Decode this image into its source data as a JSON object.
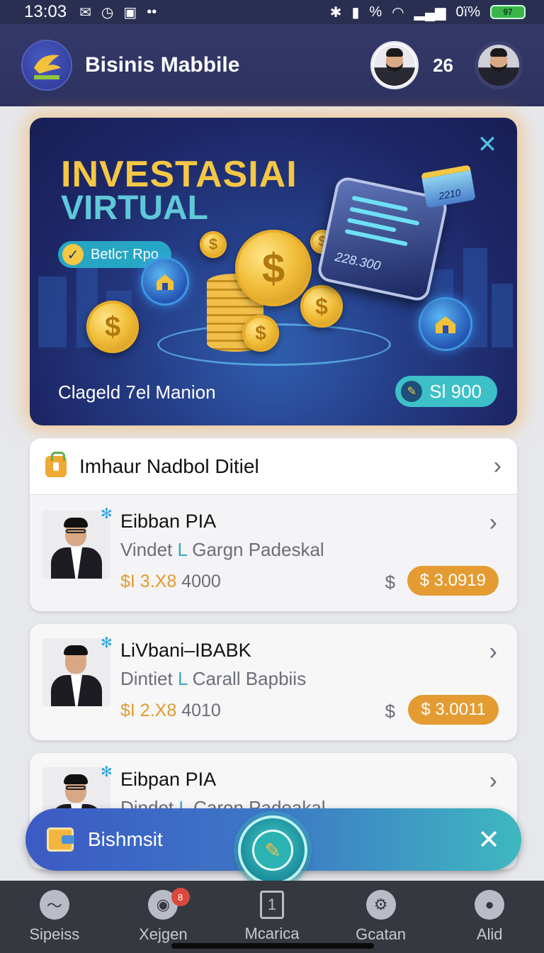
{
  "status_bar": {
    "time": "13:03",
    "battery_text": "97",
    "signal_text": "0ï%"
  },
  "header": {
    "logo_text": "Bisinis",
    "title": "Bisinis Mabbile",
    "count": "26"
  },
  "banner": {
    "headline_line1": "INVESTASIAI",
    "headline_line2": "VIRTUAL",
    "pill_label": "Betlст Rpo",
    "phone_value": "228.300",
    "chip_value": "2210",
    "caption": "Clageld 7el Manion",
    "amount": "Sl 900"
  },
  "section": {
    "title": "Imhaur Nadbol Ditiel"
  },
  "people": [
    {
      "name": "Eibban PIA",
      "sub_a": "Vindet",
      "sub_sep": "L",
      "sub_b": "Gargn Padeskal",
      "value_main": "$I 3.X8",
      "value_tail": "4000",
      "currency": "$",
      "badge": "$ 3.0919"
    },
    {
      "name": "LiVbani–IBABK",
      "sub_a": "Dintiet",
      "sub_sep": "L",
      "sub_b": "Carall Bapbiis",
      "value_main": "$I 2.X8",
      "value_tail": "4010",
      "currency": "$",
      "badge": "$ 3.0011"
    },
    {
      "name": "Eibpan PIA",
      "sub_a": "Dindet",
      "sub_sep": "L",
      "sub_b": "Caron Padeakal"
    }
  ],
  "floatbar": {
    "label": "Bishmsit"
  },
  "nav": [
    {
      "label": "Sipeiss",
      "icon": "wave-icon"
    },
    {
      "label": "Xejgen",
      "icon": "gamepad-icon",
      "badge": "8"
    },
    {
      "label": "Mcarica",
      "icon": "document-icon"
    },
    {
      "label": "Gcatan",
      "icon": "gear-icon"
    },
    {
      "label": "Alid",
      "icon": "user-icon"
    }
  ],
  "colors": {
    "appbar": "#2d3260",
    "accent_orange": "#e39b32",
    "accent_teal": "#3dc0c7",
    "banner_gold": "#f4c744",
    "banner_cyan": "#5fc9d9"
  }
}
